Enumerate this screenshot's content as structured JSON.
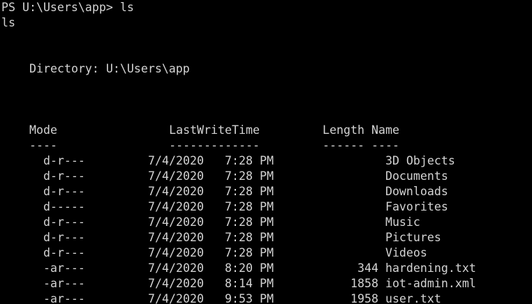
{
  "terminal": {
    "prompt_line": "PS U:\\Users\\app> ls",
    "echo_line": "ls",
    "directory_line": "Directory: U:\\Users\\app",
    "headers": {
      "mode": "Mode",
      "last_write_time": "LastWriteTime",
      "length": "Length",
      "name": "Name"
    },
    "underlines": {
      "mode": "----",
      "last_write_time": "-------------",
      "length": "------",
      "name": "----"
    },
    "rows": [
      {
        "mode": "d-r---",
        "date": "7/4/2020",
        "time": "7:28 PM",
        "length": "",
        "name": "3D Objects"
      },
      {
        "mode": "d-r---",
        "date": "7/4/2020",
        "time": "7:28 PM",
        "length": "",
        "name": "Documents"
      },
      {
        "mode": "d-r---",
        "date": "7/4/2020",
        "time": "7:28 PM",
        "length": "",
        "name": "Downloads"
      },
      {
        "mode": "d-----",
        "date": "7/4/2020",
        "time": "7:28 PM",
        "length": "",
        "name": "Favorites"
      },
      {
        "mode": "d-r---",
        "date": "7/4/2020",
        "time": "7:28 PM",
        "length": "",
        "name": "Music"
      },
      {
        "mode": "d-r---",
        "date": "7/4/2020",
        "time": "7:28 PM",
        "length": "",
        "name": "Pictures"
      },
      {
        "mode": "d-r---",
        "date": "7/4/2020",
        "time": "7:28 PM",
        "length": "",
        "name": "Videos"
      },
      {
        "mode": "-ar---",
        "date": "7/4/2020",
        "time": "8:20 PM",
        "length": "344",
        "name": "hardening.txt"
      },
      {
        "mode": "-ar---",
        "date": "7/4/2020",
        "time": "8:14 PM",
        "length": "1858",
        "name": "iot-admin.xml"
      },
      {
        "mode": "-ar---",
        "date": "7/4/2020",
        "time": "9:53 PM",
        "length": "1958",
        "name": "user.txt"
      }
    ]
  }
}
